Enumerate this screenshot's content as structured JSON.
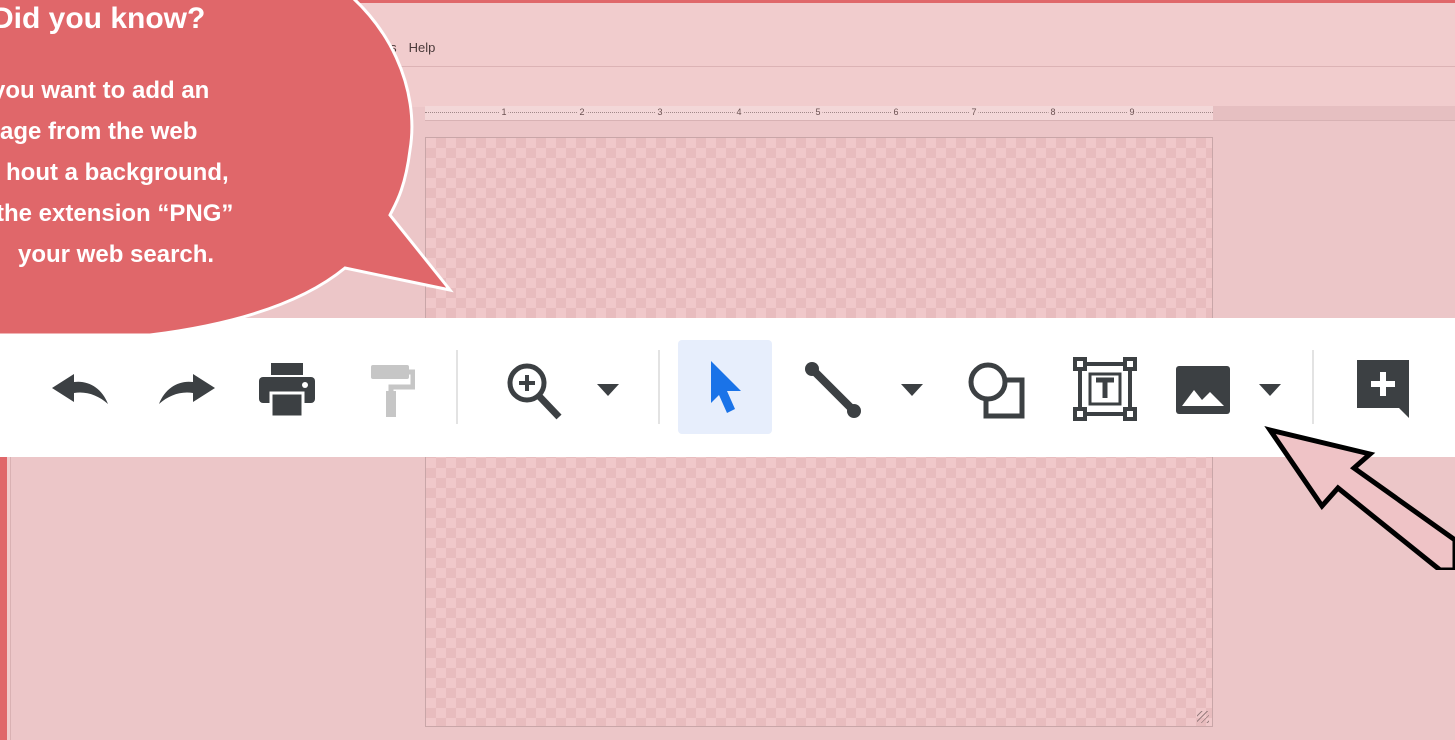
{
  "menu": {
    "items": [
      "ols",
      "Help"
    ]
  },
  "ruler": {
    "ticks": [
      "1",
      "2",
      "3",
      "4",
      "5",
      "6",
      "7",
      "8",
      "9"
    ]
  },
  "callout": {
    "title": "Did you know?",
    "lines": [
      "you want to add an",
      "age from the web",
      "hout a background,",
      "the extension “PNG”",
      "your web search."
    ]
  },
  "toolbar": {
    "buttons": [
      {
        "name": "undo-icon"
      },
      {
        "name": "redo-icon"
      },
      {
        "name": "print-icon"
      },
      {
        "name": "paint-format-icon"
      },
      {
        "name": "zoom-icon"
      },
      {
        "name": "select-arrow-icon"
      },
      {
        "name": "line-icon"
      },
      {
        "name": "shape-icon"
      },
      {
        "name": "text-box-icon"
      },
      {
        "name": "image-icon"
      },
      {
        "name": "add-comment-icon"
      }
    ],
    "selected_tool": "select"
  },
  "colors": {
    "accent_red": "#e0676a",
    "select_blue": "#1a73e8",
    "icon_gray": "#3c4043"
  }
}
